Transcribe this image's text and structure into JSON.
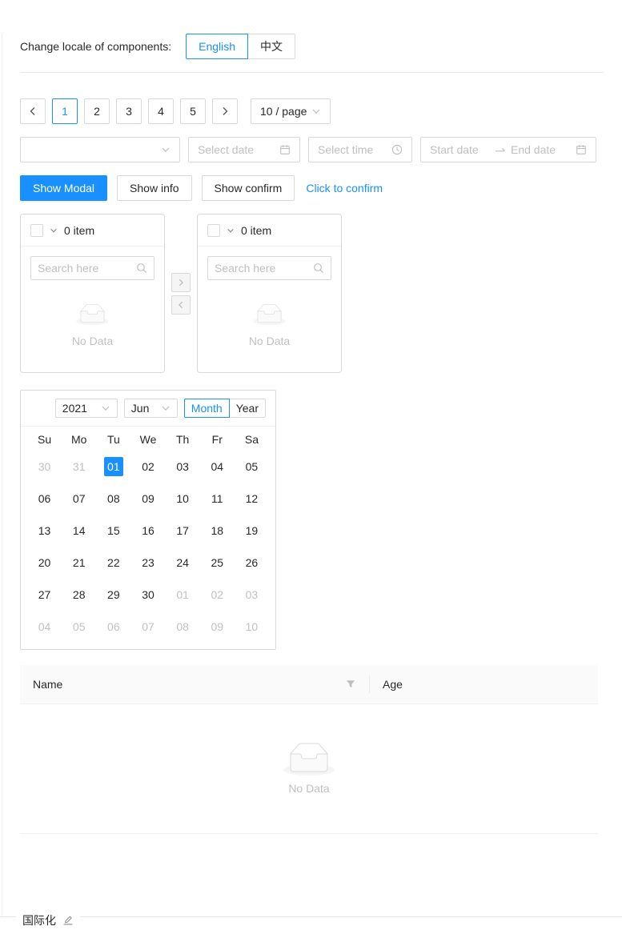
{
  "locale": {
    "label": "Change locale of components:",
    "options": {
      "english": "English",
      "chinese": "中文"
    },
    "selected": "English"
  },
  "pagination": {
    "pages": [
      "1",
      "2",
      "3",
      "4",
      "5"
    ],
    "active": "1",
    "size_label": "10 / page"
  },
  "pickers": {
    "date_placeholder": "Select date",
    "time_placeholder": "Select time",
    "range_start": "Start date",
    "range_end": "End date"
  },
  "buttons": {
    "modal": "Show Modal",
    "info": "Show info",
    "confirm": "Show confirm",
    "popconfirm": "Click to confirm"
  },
  "transfer": {
    "source": {
      "count": "0 item",
      "search_placeholder": "Search here",
      "empty": "No Data"
    },
    "target": {
      "count": "0 item",
      "search_placeholder": "Search here",
      "empty": "No Data"
    }
  },
  "calendar": {
    "year": "2021",
    "month": "Jun",
    "modes": {
      "month": "Month",
      "year": "Year"
    },
    "selected_mode": "Month",
    "selected_date": "01",
    "weekdays": [
      "Su",
      "Mo",
      "Tu",
      "We",
      "Th",
      "Fr",
      "Sa"
    ],
    "rows": [
      [
        "30",
        "31",
        "01",
        "02",
        "03",
        "04",
        "05"
      ],
      [
        "06",
        "07",
        "08",
        "09",
        "10",
        "11",
        "12"
      ],
      [
        "13",
        "14",
        "15",
        "16",
        "17",
        "18",
        "19"
      ],
      [
        "20",
        "21",
        "22",
        "23",
        "24",
        "25",
        "26"
      ],
      [
        "27",
        "28",
        "29",
        "30",
        "01",
        "02",
        "03"
      ],
      [
        "04",
        "05",
        "06",
        "07",
        "08",
        "09",
        "10"
      ]
    ]
  },
  "table": {
    "columns": {
      "name": "Name",
      "age": "Age"
    },
    "empty": "No Data"
  },
  "footer": {
    "title": "国际化"
  },
  "colors": {
    "primary": "#1890ff",
    "border": "#d9d9d9",
    "muted_text": "#bfbfbf",
    "table_header_bg": "#fafafa"
  }
}
